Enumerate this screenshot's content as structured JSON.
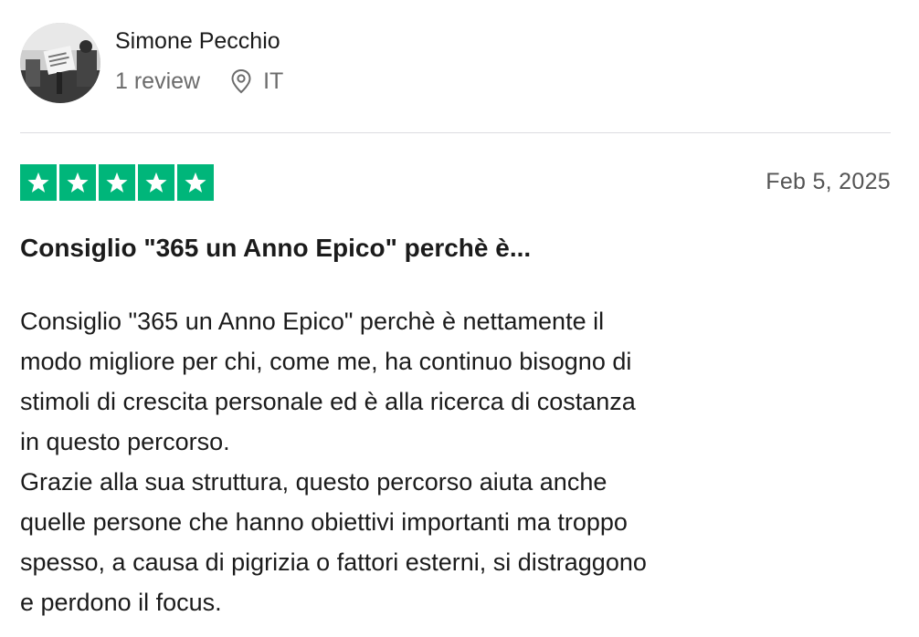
{
  "reviewer": {
    "name": "Simone Pecchio",
    "review_count": "1 review",
    "country": "IT"
  },
  "review": {
    "rating": 5,
    "rating_color": "#00b67a",
    "date": "Feb 5, 2025",
    "title": "Consiglio \"365 un Anno Epico\" perchè è...",
    "paragraphs": [
      "Consiglio \"365 un Anno Epico\" perchè è nettamente il\nmodo migliore per chi, come me, ha continuo bisogno di\nstimoli di crescita personale ed è alla ricerca di costanza\nin questo percorso.",
      "Grazie alla sua struttura, questo percorso aiuta anche\nquelle persone che hanno obiettivi importanti ma troppo\nspesso, a causa di pigrizia o fattori esterni, si distraggono\ne perdono il focus."
    ]
  },
  "icons": {
    "location": "location-pin-icon",
    "star": "star-icon"
  }
}
